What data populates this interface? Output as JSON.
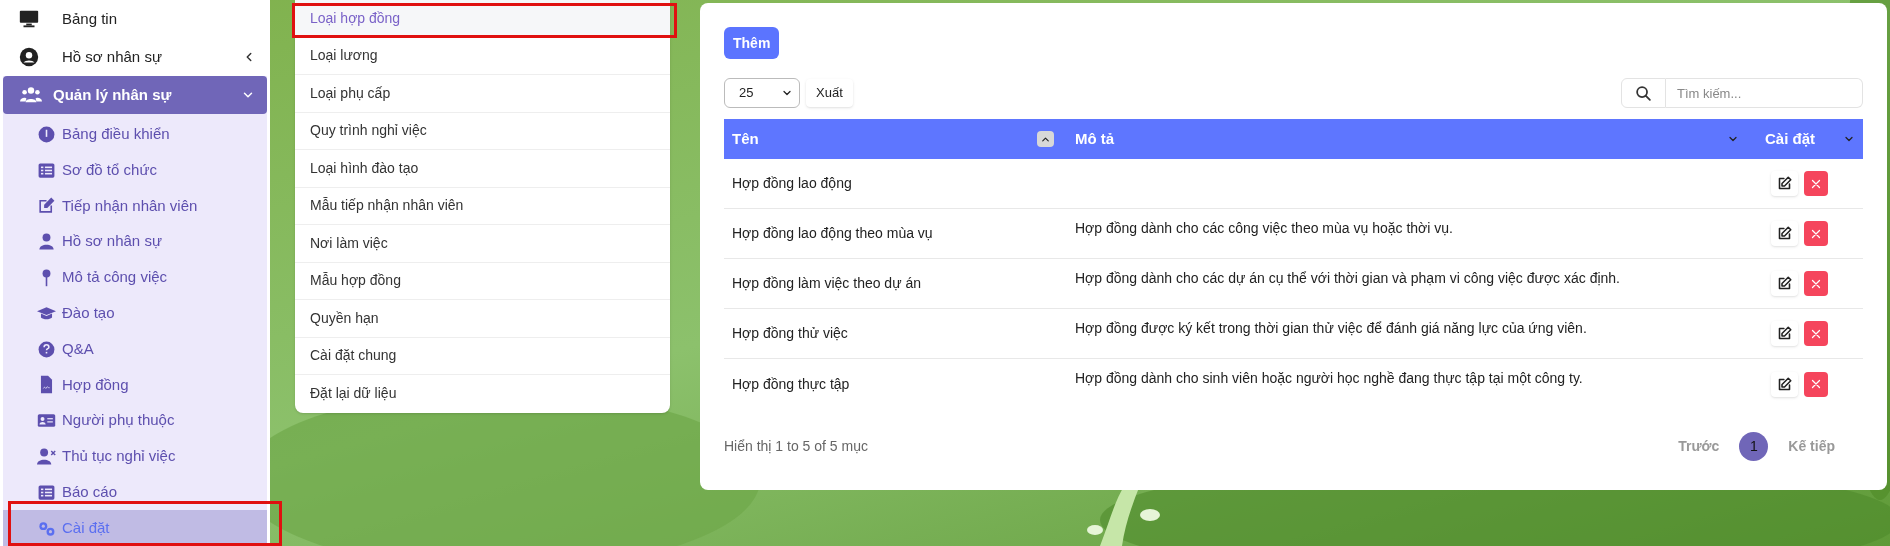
{
  "sidebar": {
    "items": [
      {
        "label": "Bảng tin"
      },
      {
        "label": "Hồ sơ nhân sự",
        "expanded": false
      }
    ],
    "group": {
      "label": "Quản lý nhân sự",
      "expanded": true,
      "children": [
        {
          "label": "Bảng điều khiển",
          "selected": false
        },
        {
          "label": "Sơ đồ tổ chức",
          "selected": false
        },
        {
          "label": "Tiếp nhận nhân viên",
          "selected": false
        },
        {
          "label": "Hồ sơ nhân sự",
          "selected": false
        },
        {
          "label": "Mô tả công việc",
          "selected": false
        },
        {
          "label": "Đào tạo",
          "selected": false
        },
        {
          "label": "Q&A",
          "selected": false
        },
        {
          "label": "Hợp đồng",
          "selected": false
        },
        {
          "label": "Người phụ thuộc",
          "selected": false
        },
        {
          "label": "Thủ tục nghỉ việc",
          "selected": false
        },
        {
          "label": "Báo cáo",
          "selected": false
        },
        {
          "label": "Cài đặt",
          "selected": true
        }
      ]
    }
  },
  "settings_menu": [
    {
      "label": "Loại hợp đồng",
      "selected": true
    },
    {
      "label": "Loại lương",
      "selected": false
    },
    {
      "label": "Loại phụ cấp",
      "selected": false
    },
    {
      "label": "Quy trình nghỉ việc",
      "selected": false
    },
    {
      "label": "Loại hình đào tạo",
      "selected": false
    },
    {
      "label": "Mẫu tiếp nhận nhân viên",
      "selected": false
    },
    {
      "label": "Nơi làm việc",
      "selected": false
    },
    {
      "label": "Mẫu hợp đồng",
      "selected": false
    },
    {
      "label": "Quyền hạn",
      "selected": false
    },
    {
      "label": "Cài đặt chung",
      "selected": false
    },
    {
      "label": "Đặt lại dữ liệu",
      "selected": false
    }
  ],
  "toolbar": {
    "add_button": "Thêm",
    "page_size": "25",
    "export_button": "Xuất",
    "search": {
      "placeholder": "Tìm kiếm..."
    }
  },
  "table": {
    "columns": [
      "Tên",
      "Mô tả",
      "Cài đặt"
    ],
    "rows": [
      {
        "name": "Hợp đồng lao động"
      },
      {
        "name": "Hợp đồng lao động theo mùa vụ",
        "description": "Hợp đồng dành cho các công việc theo mùa vụ hoặc thời vụ."
      },
      {
        "name": "Hợp đồng làm việc theo dự án",
        "description": "Hợp đồng dành cho các dự án cụ thể với thời gian và phạm vi công việc được xác định."
      },
      {
        "name": "Hợp đồng thử việc",
        "description": "Hợp đồng được ký kết trong thời gian thử việc để đánh giá năng lực của ứng viên."
      },
      {
        "name": "Hợp đồng thực tập",
        "description": "Hợp đồng dành cho sinh viên hoặc người học nghề đang thực tập tại một công ty."
      }
    ]
  },
  "footer": {
    "summary": "Hiển thị 1 to 5 of 5 mục",
    "pagination": {
      "previous": "Trước",
      "pages": [
        {
          "label": "1",
          "selected": true
        }
      ],
      "next": "Kế tiếp"
    }
  }
}
